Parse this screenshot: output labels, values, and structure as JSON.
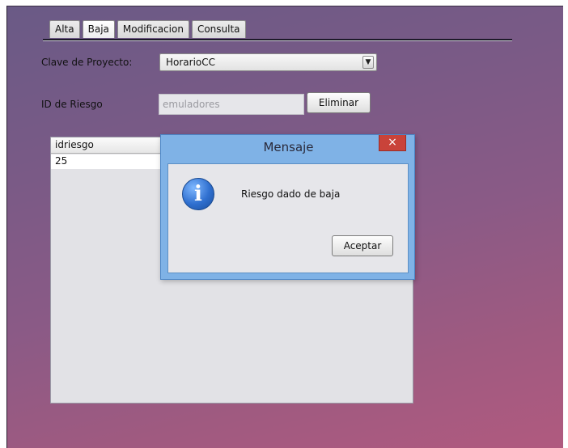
{
  "tabs": [
    {
      "label": "Alta",
      "active": false
    },
    {
      "label": "Baja",
      "active": true
    },
    {
      "label": "Modificacion",
      "active": false
    },
    {
      "label": "Consulta",
      "active": false
    }
  ],
  "form": {
    "project_key_label": "Clave de Proyecto:",
    "project_key_value": "HorarioCC",
    "risk_id_label": "ID de Riesgo",
    "risk_id_value": "emuladores",
    "delete_button": "Eliminar"
  },
  "table": {
    "columns": [
      "idriesgo",
      "",
      ""
    ],
    "rows": [
      [
        "25",
        "",
        ""
      ]
    ]
  },
  "dialog": {
    "title": "Mensaje",
    "close_icon": "×",
    "icon": "info-icon",
    "icon_glyph": "i",
    "message": "Riesgo dado de baja",
    "ok_button": "Aceptar"
  },
  "colors": {
    "dialog_frame": "#7fb2e6",
    "close_button": "#c9433a",
    "background_start": "#6a5a86",
    "background_end": "#b05a7f"
  }
}
